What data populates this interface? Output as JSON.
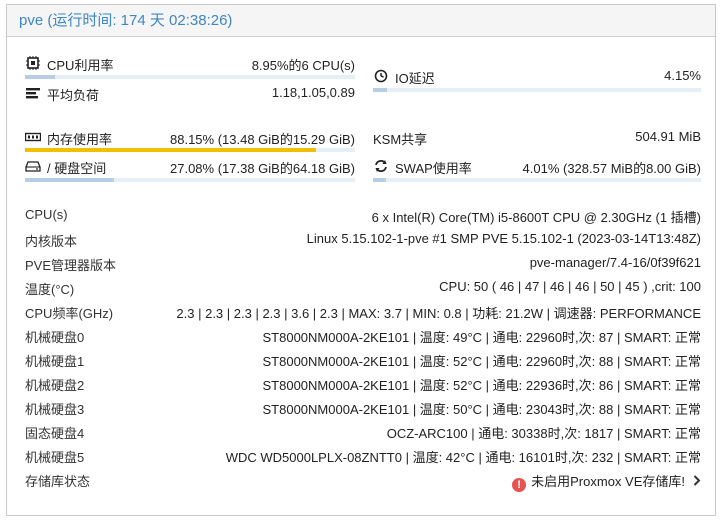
{
  "header": {
    "title": "pve (运行时间: 174 天 02:38:26)"
  },
  "metrics": {
    "cpu": {
      "icon": "cpu-icon",
      "label": "CPU利用率",
      "value": "8.95%的6 CPU(s)",
      "percent": 8.95
    },
    "load": {
      "icon": "load-average-icon",
      "label": "平均负荷",
      "value": "1.18,1.05,0.89"
    },
    "io": {
      "icon": "io-delay-icon",
      "label": "IO延迟",
      "value": "4.15%",
      "percent": 4.15
    },
    "memory": {
      "icon": "memory-icon",
      "label": "内存使用率",
      "value": "88.15% (13.48 GiB的15.29 GiB)",
      "percent": 88.15
    },
    "ksm": {
      "label": "KSM共享",
      "value": "504.91 MiB"
    },
    "disk": {
      "icon": "hdd-icon",
      "label": "/ 硬盘空间",
      "value": "27.08% (17.38 GiB的64.18 GiB)",
      "percent": 27.08
    },
    "swap": {
      "icon": "swap-icon",
      "label": "SWAP使用率",
      "value": "4.01% (328.57 MiB的8.00 GiB)",
      "percent": 4.01
    }
  },
  "info": [
    {
      "key": "CPU(s)",
      "value": "6 x Intel(R) Core(TM) i5-8600T CPU @ 2.30GHz (1 插槽)"
    },
    {
      "key": "内核版本",
      "value": "Linux 5.15.102-1-pve #1 SMP PVE 5.15.102-1 (2023-03-14T13:48Z)"
    },
    {
      "key": "PVE管理器版本",
      "value": "pve-manager/7.4-16/0f39f621"
    },
    {
      "key": "温度(°C)",
      "value": "CPU: 50 ( 46 | 47 | 46 | 46 | 50 | 45 ) ,crit: 100"
    },
    {
      "key": "CPU频率(GHz)",
      "value": "2.3 | 2.3 | 2.3 | 2.3 | 3.6 | 2.3 | MAX: 3.7 | MIN: 0.8 | 功耗: 21.2W | 调速器: PERFORMANCE"
    },
    {
      "key": "机械硬盘0",
      "value": "ST8000NM000A-2KE101 | 温度: 49°C | 通电: 22960时,次: 87 | SMART: 正常"
    },
    {
      "key": "机械硬盘1",
      "value": "ST8000NM000A-2KE101 | 温度: 52°C | 通电: 22960时,次: 88 | SMART: 正常"
    },
    {
      "key": "机械硬盘2",
      "value": "ST8000NM000A-2KE101 | 温度: 52°C | 通电: 22936时,次: 86 | SMART: 正常"
    },
    {
      "key": "机械硬盘3",
      "value": "ST8000NM000A-2KE101 | 温度: 50°C | 通电: 23043时,次: 88 | SMART: 正常"
    },
    {
      "key": "固态硬盘4",
      "value": "OCZ-ARC100 | 通电: 30338时,次: 1817 | SMART: 正常"
    },
    {
      "key": "机械硬盘5",
      "value": "WDC WD5000LPLX-08ZNTT0 | 温度: 42°C | 通电: 16101时,次: 232 | SMART: 正常"
    }
  ],
  "repo": {
    "key": "存储库状态",
    "value": "未启用Proxmox VE存储库!",
    "icon": "error-icon",
    "chevron": "chevron-right-icon"
  },
  "colors": {
    "header_text": "#3e86c6",
    "bar_bg": "#e6eef6",
    "bar_fill": "#b6cde4",
    "bar_warn": "#f0c000",
    "error": "#e55353"
  }
}
